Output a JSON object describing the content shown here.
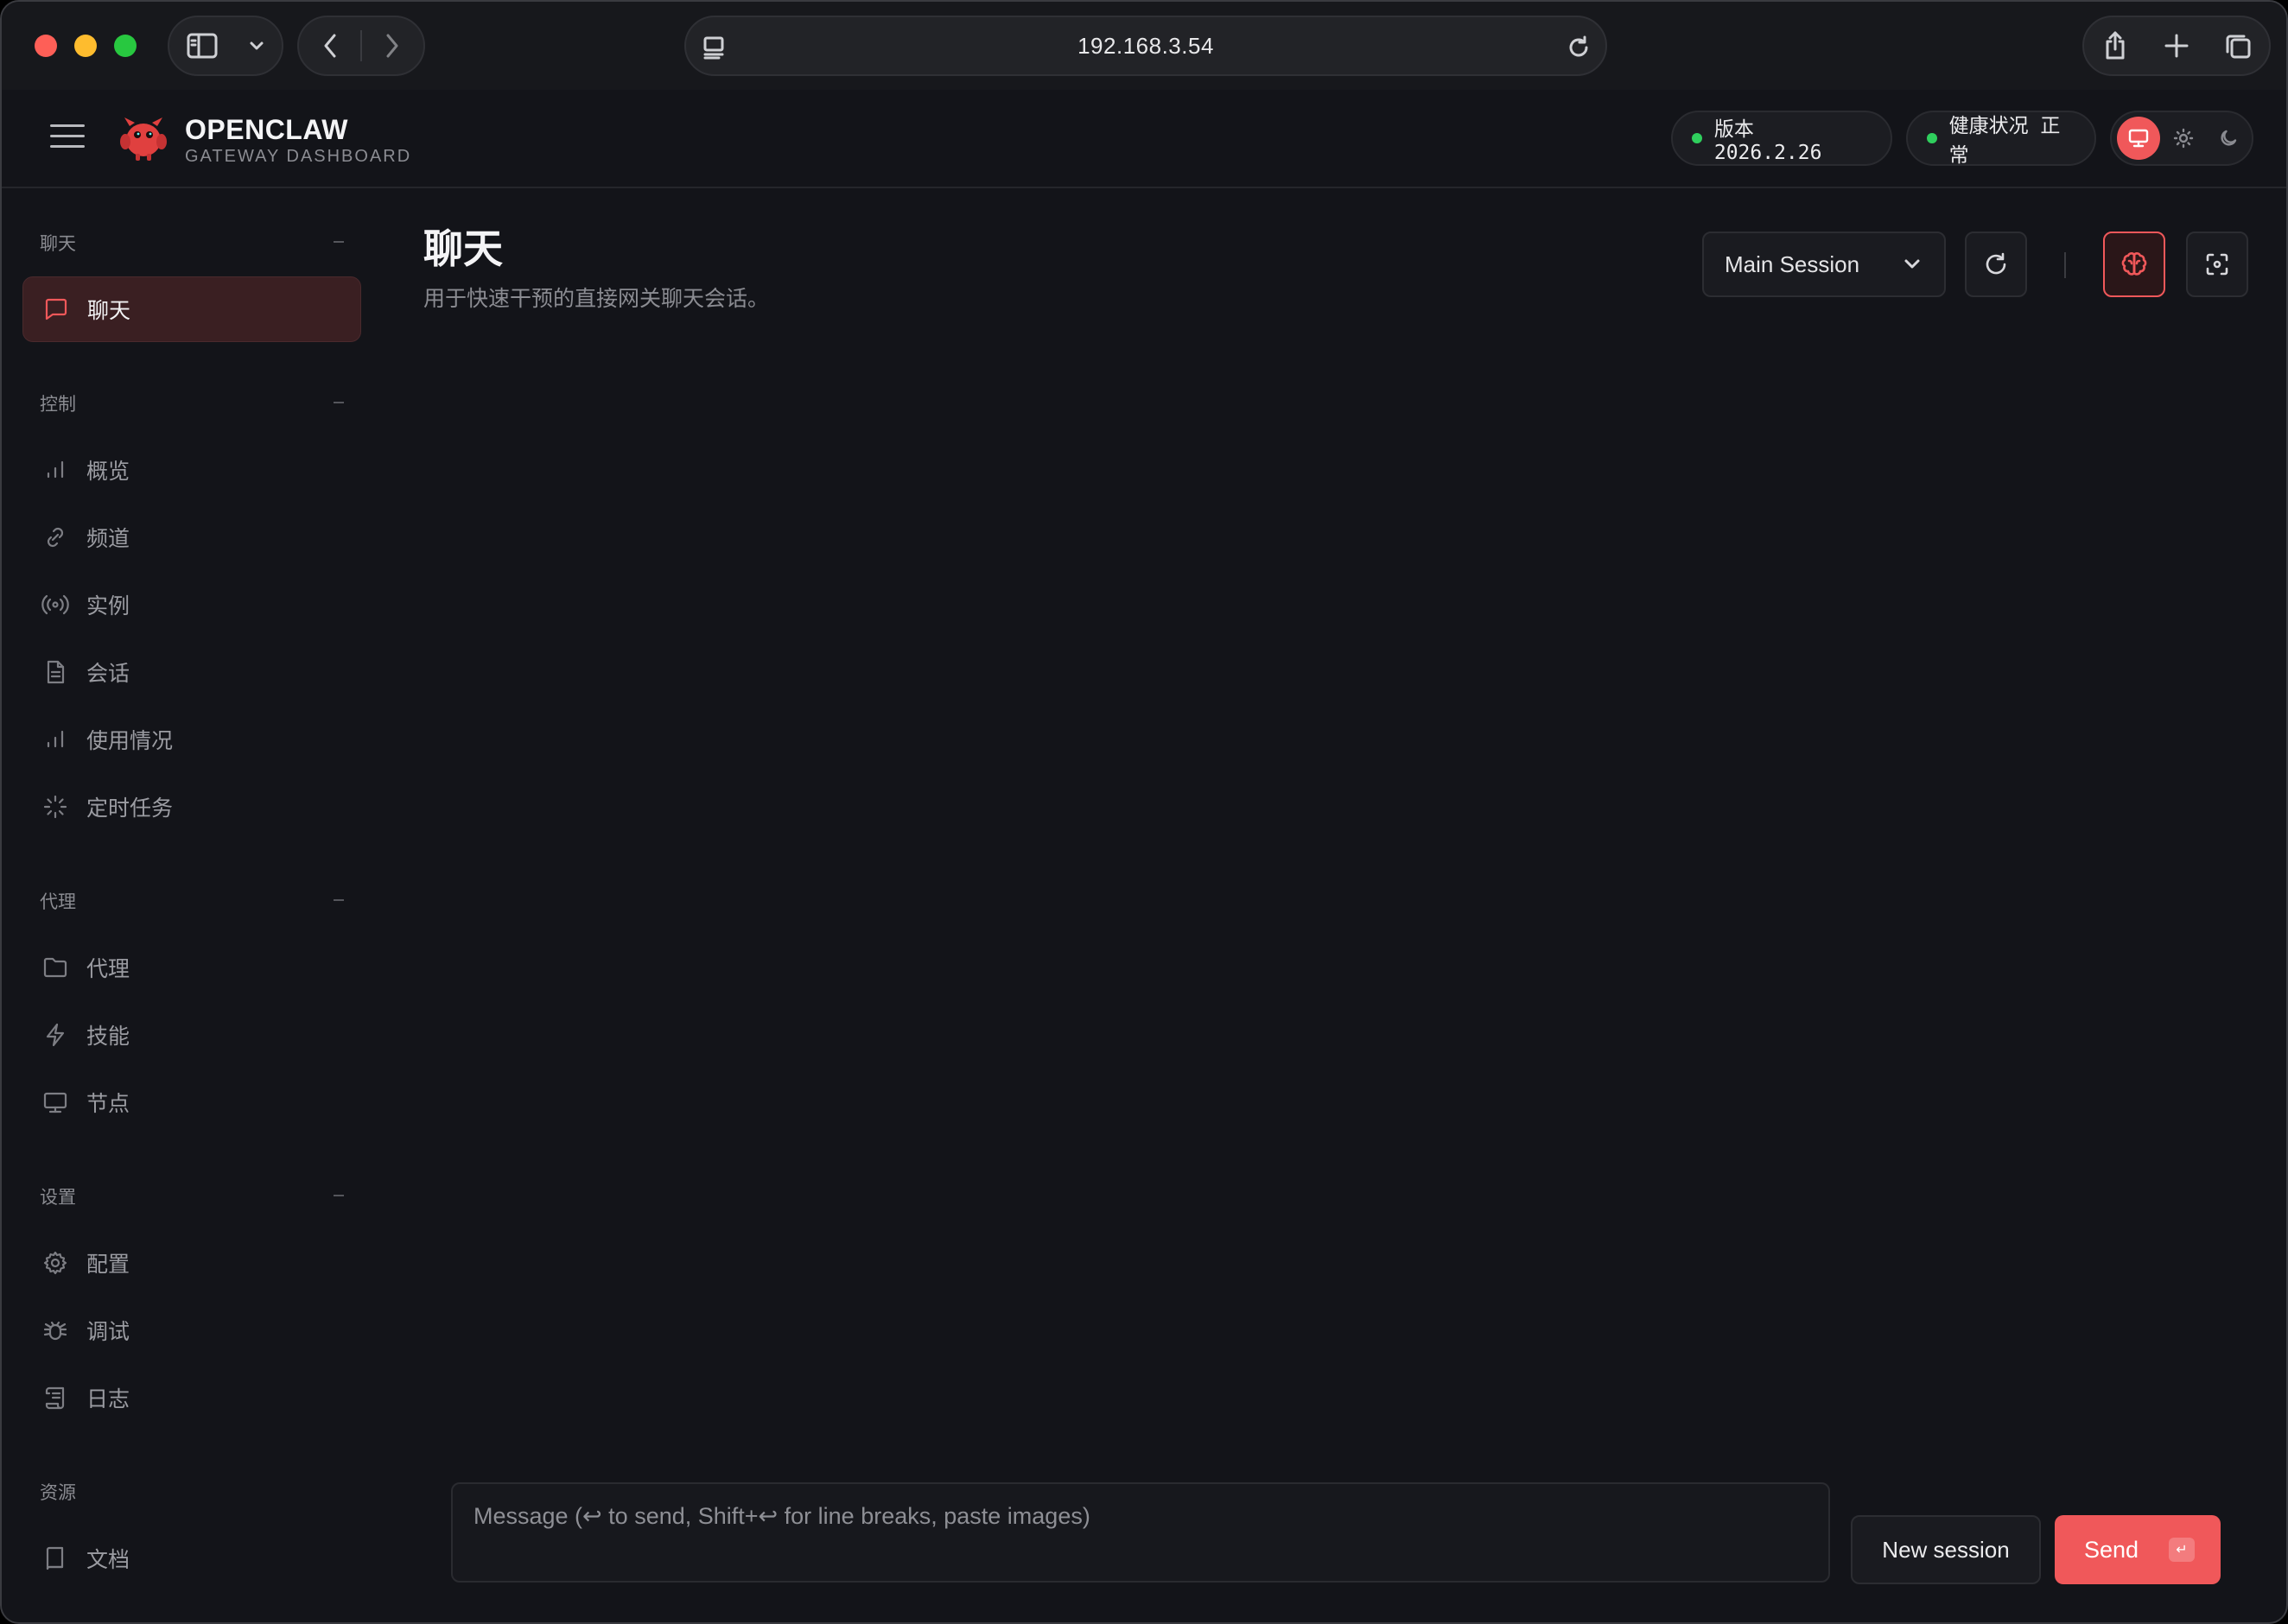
{
  "browser": {
    "url": "192.168.3.54",
    "icons": [
      "sidebar-icon",
      "chevron-down-icon",
      "back-icon",
      "forward-icon",
      "site-icon",
      "reload-icon",
      "share-icon",
      "plus-icon",
      "tabs-icon"
    ]
  },
  "header": {
    "brand_title": "OPENCLAW",
    "brand_subtitle": "GATEWAY DASHBOARD",
    "version_label": "版本 2026.2.26",
    "health_label": "健康状况 正常",
    "status_color": "#2fcf5d",
    "accent_color": "#f0585a",
    "theme_options": [
      "system",
      "light",
      "dark"
    ],
    "theme_selected": "system"
  },
  "sidebar": {
    "sections": [
      {
        "title": "聊天",
        "items": [
          {
            "label": "聊天",
            "icon": "message-icon",
            "active": true
          }
        ]
      },
      {
        "title": "控制",
        "items": [
          {
            "label": "概览",
            "icon": "bar-chart-icon"
          },
          {
            "label": "频道",
            "icon": "link-icon"
          },
          {
            "label": "实例",
            "icon": "radio-icon"
          },
          {
            "label": "会话",
            "icon": "file-icon"
          },
          {
            "label": "使用情况",
            "icon": "bar-chart-icon"
          },
          {
            "label": "定时任务",
            "icon": "loader-icon"
          }
        ]
      },
      {
        "title": "代理",
        "items": [
          {
            "label": "代理",
            "icon": "folder-icon"
          },
          {
            "label": "技能",
            "icon": "zap-icon"
          },
          {
            "label": "节点",
            "icon": "monitor-icon"
          }
        ]
      },
      {
        "title": "设置",
        "items": [
          {
            "label": "配置",
            "icon": "gear-icon"
          },
          {
            "label": "调试",
            "icon": "bug-icon"
          },
          {
            "label": "日志",
            "icon": "scroll-icon"
          }
        ]
      },
      {
        "title": "资源",
        "items": [
          {
            "label": "文档",
            "icon": "book-icon"
          }
        ]
      }
    ]
  },
  "main": {
    "title": "聊天",
    "subtitle": "用于快速干预的直接网关聊天会话。",
    "session_select": "Main Session",
    "composer_placeholder": "Message (↩ to send, Shift+↩ for line breaks, paste images)",
    "composer_value": "",
    "new_session_label": "New session",
    "send_label": "Send",
    "send_shortcut": "↵"
  }
}
